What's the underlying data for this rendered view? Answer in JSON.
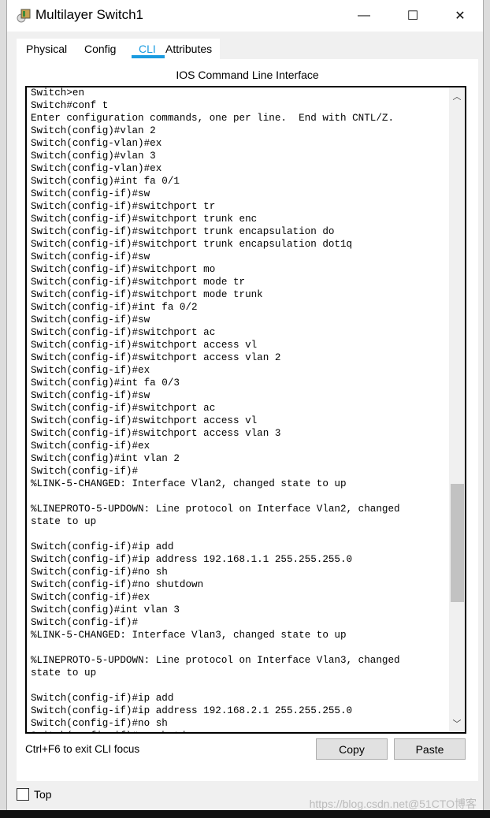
{
  "window": {
    "title": "Multilayer Switch1",
    "minimize": "—",
    "maximize": "☐",
    "close": "✕"
  },
  "tabs": [
    {
      "label": "Physical"
    },
    {
      "label": "Config"
    },
    {
      "label": "CLI",
      "active": true
    },
    {
      "label": "Attributes"
    }
  ],
  "accent": "#1a9be0",
  "cli": {
    "title": "IOS Command Line Interface",
    "lines": [
      "Switch>en",
      "Switch#conf t",
      "Enter configuration commands, one per line.  End with CNTL/Z.",
      "Switch(config)#vlan 2",
      "Switch(config-vlan)#ex",
      "Switch(config)#vlan 3",
      "Switch(config-vlan)#ex",
      "Switch(config)#int fa 0/1",
      "Switch(config-if)#sw",
      "Switch(config-if)#switchport tr",
      "Switch(config-if)#switchport trunk enc",
      "Switch(config-if)#switchport trunk encapsulation do",
      "Switch(config-if)#switchport trunk encapsulation dot1q",
      "Switch(config-if)#sw",
      "Switch(config-if)#switchport mo",
      "Switch(config-if)#switchport mode tr",
      "Switch(config-if)#switchport mode trunk",
      "Switch(config-if)#int fa 0/2",
      "Switch(config-if)#sw",
      "Switch(config-if)#switchport ac",
      "Switch(config-if)#switchport access vl",
      "Switch(config-if)#switchport access vlan 2",
      "Switch(config-if)#ex",
      "Switch(config)#int fa 0/3",
      "Switch(config-if)#sw",
      "Switch(config-if)#switchport ac",
      "Switch(config-if)#switchport access vl",
      "Switch(config-if)#switchport access vlan 3",
      "Switch(config-if)#ex",
      "Switch(config)#int vlan 2",
      "Switch(config-if)#",
      "%LINK-5-CHANGED: Interface Vlan2, changed state to up",
      "",
      "%LINEPROTO-5-UPDOWN: Line protocol on Interface Vlan2, changed",
      "state to up",
      "",
      "Switch(config-if)#ip add",
      "Switch(config-if)#ip address 192.168.1.1 255.255.255.0",
      "Switch(config-if)#no sh",
      "Switch(config-if)#no shutdown",
      "Switch(config-if)#ex",
      "Switch(config)#int vlan 3",
      "Switch(config-if)#",
      "%LINK-5-CHANGED: Interface Vlan3, changed state to up",
      "",
      "%LINEPROTO-5-UPDOWN: Line protocol on Interface Vlan3, changed",
      "state to up",
      "",
      "Switch(config-if)#ip add",
      "Switch(config-if)#ip address 192.168.2.1 255.255.255.0",
      "Switch(config-if)#no sh",
      "Switch(config-if)#no shutdown"
    ],
    "hint": "Ctrl+F6 to exit CLI focus",
    "copy": "Copy",
    "paste": "Paste"
  },
  "top": {
    "label": "Top",
    "checked": false
  },
  "watermark": "https://blog.csdn.net@51CTO博客"
}
